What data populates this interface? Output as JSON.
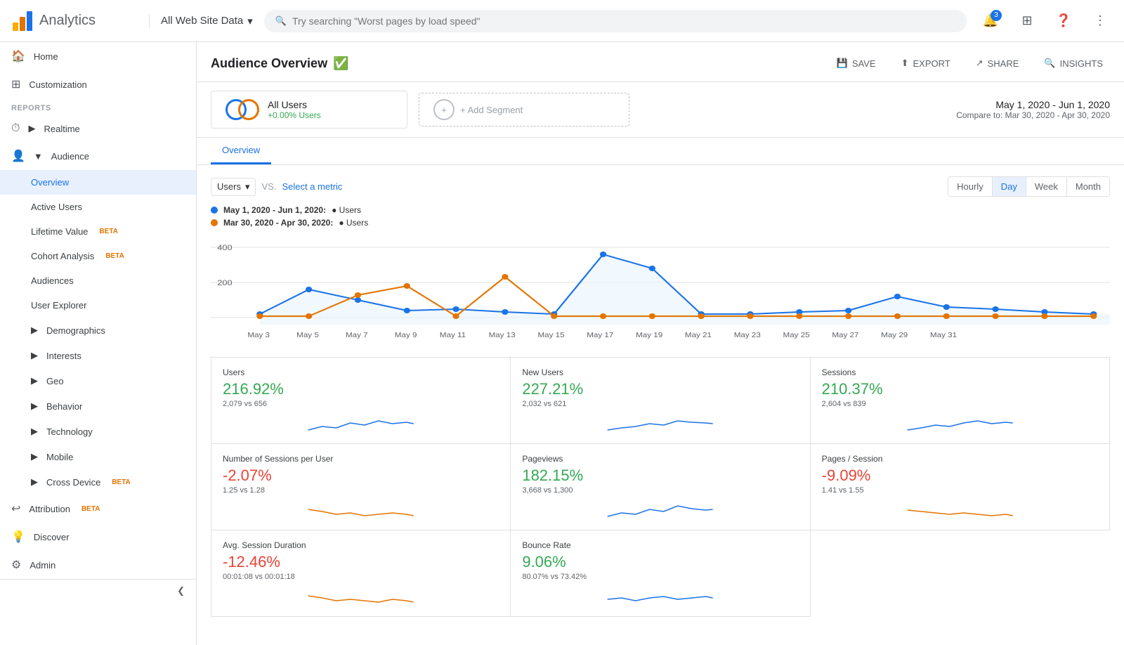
{
  "header": {
    "app_title": "Analytics",
    "property": "All Web Site Data",
    "search_placeholder": "Try searching \"Worst pages by load speed\"",
    "notification_count": "3"
  },
  "sidebar": {
    "home_label": "Home",
    "customization_label": "Customization",
    "reports_label": "REPORTS",
    "realtime_label": "Realtime",
    "audience_label": "Audience",
    "overview_label": "Overview",
    "active_users_label": "Active Users",
    "lifetime_value_label": "Lifetime Value",
    "lifetime_value_beta": "BETA",
    "cohort_analysis_label": "Cohort Analysis",
    "cohort_analysis_beta": "BETA",
    "audiences_label": "Audiences",
    "user_explorer_label": "User Explorer",
    "demographics_label": "Demographics",
    "interests_label": "Interests",
    "geo_label": "Geo",
    "behavior_label": "Behavior",
    "technology_label": "Technology",
    "mobile_label": "Mobile",
    "cross_device_label": "Cross Device",
    "cross_device_beta": "BETA",
    "attribution_label": "Attribution",
    "attribution_beta": "BETA",
    "discover_label": "Discover",
    "admin_label": "Admin"
  },
  "page": {
    "title": "Audience Overview",
    "save_label": "SAVE",
    "export_label": "EXPORT",
    "share_label": "SHARE",
    "insights_label": "INSIGHTS"
  },
  "segment": {
    "name": "All Users",
    "stat": "+0.00% Users",
    "add_label": "+ Add Segment",
    "date_main": "May 1, 2020 - Jun 1, 2020",
    "date_compare": "Compare to: Mar 30, 2020 - Apr 30, 2020"
  },
  "tabs": [
    {
      "label": "Overview",
      "active": true
    }
  ],
  "chart": {
    "metric_label": "Users",
    "vs_label": "VS.",
    "select_metric_label": "Select a metric",
    "time_buttons": [
      {
        "label": "Hourly",
        "active": false
      },
      {
        "label": "Day",
        "active": true
      },
      {
        "label": "Week",
        "active": false
      },
      {
        "label": "Month",
        "active": false
      }
    ],
    "legend": [
      {
        "label": "May 1, 2020 - Jun 1, 2020:",
        "period_label": "Users",
        "color": "#1a73e8"
      },
      {
        "label": "Mar 30, 2020 - Apr 30, 2020:",
        "period_label": "Users",
        "color": "#e37400"
      }
    ],
    "y_labels": [
      "400",
      "200"
    ],
    "x_labels": [
      "May 3",
      "May 5",
      "May 7",
      "May 9",
      "May 11",
      "May 13",
      "May 15",
      "May 17",
      "May 19",
      "May 21",
      "May 23",
      "May 25",
      "May 27",
      "May 29",
      "May 31"
    ]
  },
  "metrics": [
    {
      "name": "Users",
      "value": "216.92%",
      "positive": true,
      "sub": "2,079 vs 656"
    },
    {
      "name": "New Users",
      "value": "227.21%",
      "positive": true,
      "sub": "2,032 vs 621"
    },
    {
      "name": "Sessions",
      "value": "210.37%",
      "positive": true,
      "sub": "2,604 vs 839"
    },
    {
      "name": "Number of Sessions per User",
      "value": "-2.07%",
      "positive": false,
      "sub": "1.25 vs 1.28"
    },
    {
      "name": "Pageviews",
      "value": "182.15%",
      "positive": true,
      "sub": "3,668 vs 1,300"
    },
    {
      "name": "Pages / Session",
      "value": "-9.09%",
      "positive": false,
      "sub": "1.41 vs 1.55"
    },
    {
      "name": "Avg. Session Duration",
      "value": "-12.46%",
      "positive": false,
      "sub": "00:01:08 vs 00:01:18"
    },
    {
      "name": "Bounce Rate",
      "value": "9.06%",
      "positive": true,
      "sub": "80.07% vs 73.42%"
    }
  ]
}
